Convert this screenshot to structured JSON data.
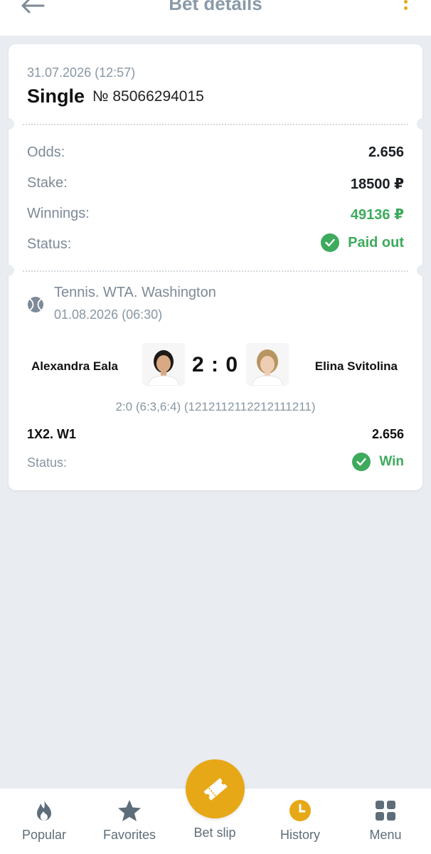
{
  "header": {
    "title": "Bet details"
  },
  "bet": {
    "datetime": "31.07.2026 (12:57)",
    "type": "Single",
    "number": "№ 85066294015",
    "rows": {
      "odds_label": "Odds:",
      "odds_value": "2.656",
      "stake_label": "Stake:",
      "stake_value": "18500 ₽",
      "winnings_label": "Winnings:",
      "winnings_value": "49136 ₽",
      "status_label": "Status:",
      "status_value": "Paid out"
    }
  },
  "event": {
    "league": "Tennis. WTA. Washington",
    "date": "01.08.2026 (06:30)",
    "team1": "Alexandra Eala",
    "team2": "Elina Svitolina",
    "score": "2 : 0",
    "sets": "2:0 (6:3,6:4) (121211211221211121​1)",
    "market": "1X2. W1",
    "market_odds": "2.656",
    "status_label": "Status:",
    "status_value": "Win"
  },
  "nav": {
    "popular": "Popular",
    "favorites": "Favorites",
    "betslip": "Bet slip",
    "history": "History",
    "menu": "Menu"
  },
  "colors": {
    "accent": "#e6a817",
    "success": "#3daa5c",
    "muted": "#8896a3",
    "background": "#e9ecf0"
  },
  "icons": [
    "back-arrow-icon",
    "more-vertical-icon",
    "check-circle-icon",
    "tennis-ball-icon",
    "fire-icon",
    "star-icon",
    "ticket-icon",
    "clock-icon",
    "grid-icon"
  ]
}
